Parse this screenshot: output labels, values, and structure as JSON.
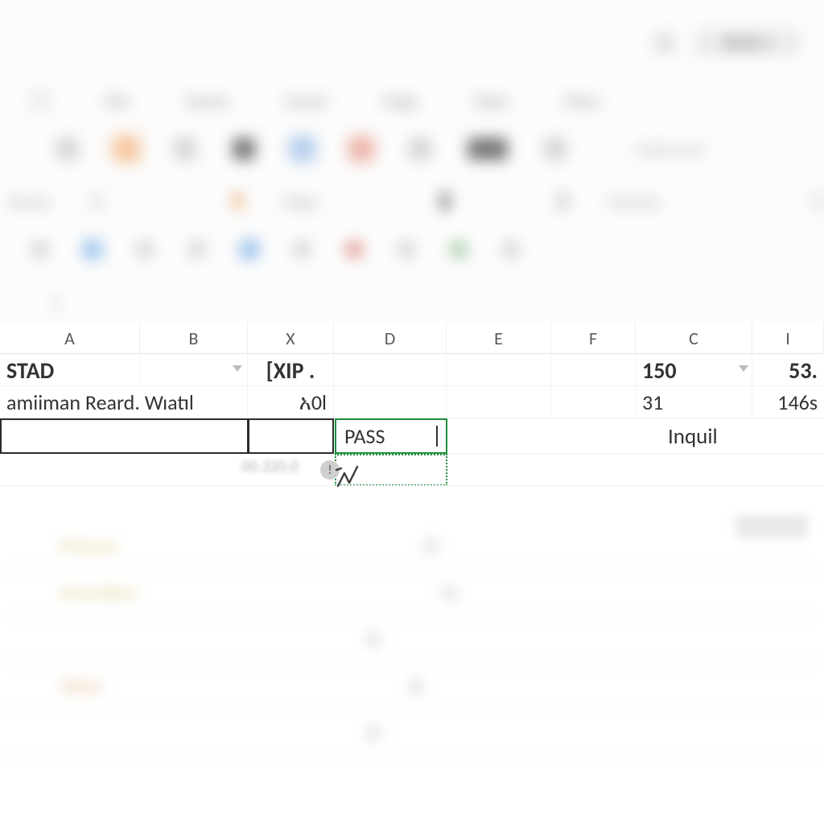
{
  "title_button": "Book 1",
  "tabs": [
    "File",
    "Home",
    "Insert",
    "Page",
    "Data",
    "View"
  ],
  "groups": {
    "g1": "Name",
    "g2": "Align",
    "g3": "Format"
  },
  "name_box": "B",
  "columns": {
    "A": "A",
    "B": "B",
    "X": "X",
    "D": "D",
    "E": "E",
    "F": "F",
    "C": "C",
    "I": "I"
  },
  "grid": {
    "row1": {
      "A": "STAD",
      "X": "[XIP .",
      "C": "150",
      "I": "53."
    },
    "row2": {
      "A": "amiiman Reard. Wıatıl",
      "X": "አ0l",
      "C": "31",
      "I": "146s"
    },
    "row3": {
      "pass": "PASS",
      "inquil": "Inquil"
    },
    "row4": {
      "status": "00.320.0"
    }
  },
  "error_icon_glyph": "!",
  "ghost_labels": [
    "Primary",
    "Secondary",
    "",
    "Other",
    ""
  ]
}
